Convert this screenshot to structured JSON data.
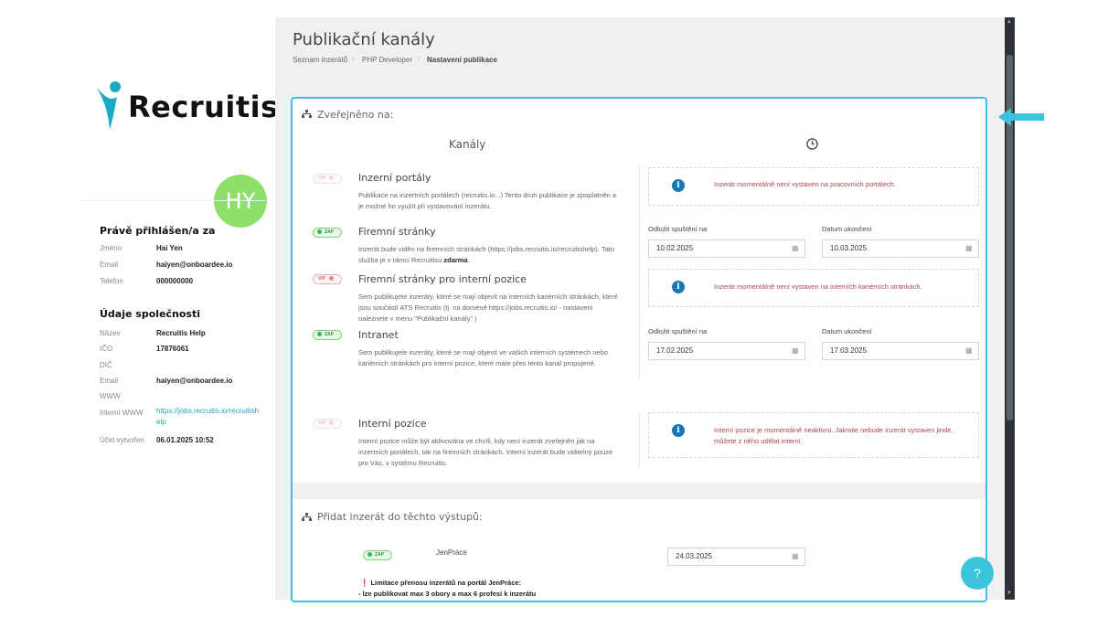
{
  "brand": {
    "logo_text": "Recruitis",
    "accent": "#3cc3dc"
  },
  "user": {
    "initials": "HY",
    "logged_in_title": "Právě přihlášen/a za",
    "fields": [
      {
        "label": "Jméno",
        "value": "Hai Yen"
      },
      {
        "label": "Email",
        "value": "haiyen@onboardee.io"
      },
      {
        "label": "Telefon",
        "value": "000000000"
      }
    ]
  },
  "company": {
    "title": "Údaje společnosti",
    "fields": [
      {
        "label": "Název",
        "value": "Recruitis Help"
      },
      {
        "label": "IČO",
        "value": "17876061"
      },
      {
        "label": "DIČ",
        "value": ""
      },
      {
        "label": "Email",
        "value": "haiyen@onboardee.io"
      },
      {
        "label": "WWW",
        "value": ""
      },
      {
        "label": "Interní WWW",
        "value": "https://jobs.recruitis.io/recruitishelp"
      },
      {
        "label": "Účet vytvořen",
        "value": "06.01.2025 10:52"
      }
    ]
  },
  "page": {
    "title": "Publikační kanály",
    "breadcrumb": [
      "Seznam inzerátů",
      "PHP Developer",
      "Nastavení publikace"
    ]
  },
  "published": {
    "section_title": "Zveřejněno na:",
    "col_channels": "Kanály",
    "channels": [
      {
        "title": "Inzerní portály",
        "toggle": "VIP",
        "desc": "Publikace na inzertních portálech (recruitis.io...) Tento druh publikace je zpoplatněn a je možné ho využít při vystavování inzerátu.",
        "info": "Inzerát momentálně není vystaven na pracovních portálech."
      },
      {
        "title": "Firemní stránky",
        "toggle": "ZAP",
        "desc": "Inzerát bude viděn na firemních stránkách (https://jobs.recruitis.io/recruitishelp). Tato služba je v rámci Recruitisu",
        "desc_bold": "zdarma",
        "desc_end": ".",
        "start_label": "Odložit spuštění na",
        "start_value": "10.02.2025",
        "end_label": "Datum ukončení",
        "end_value": "10.03.2025"
      },
      {
        "title": "Firemní stránky pro interní pozice",
        "toggle": "VIP",
        "desc": "Sem publikujete inzeráty, které se mají objevit na interních kariérních stránkách, které jsou součástí ATS Recruitis (tj. na doméně https://jobs.recruitis.io/ - nastavení naleznete v menu \"Publikační kanály\" )",
        "info": "Inzerát momentálně není vystaven na interních kariérních stránkách."
      },
      {
        "title": "Intranet",
        "toggle": "ZAP",
        "desc": "Sem publikujete inzeráty, které se mají objevit ve vašich interních systémech nebo kariérních stránkách pro interní pozice, které máte přes tento kanál propojené.",
        "start_label": "Odložit spuštění na",
        "start_value": "17.02.2025",
        "end_label": "Datum ukončení",
        "end_value": "17.03.2025"
      },
      {
        "title": "Interní pozice",
        "toggle": "VIP",
        "desc": "Interní pozice může být aktivována ve chvíli, kdy není inzerát zveřejněn jak na inzertních portálech, tak na firemních stránkách. Interní inzerát bude viditelný pouze pro Vás, v systému Recruitis.",
        "info": "Interní pozice je momentálně neaktivní. Jakmile nebude inzerát vystaven jinde, můžete z něho udělat interní."
      }
    ]
  },
  "outputs": {
    "section_title": "Přidat inzerát do těchto výstupů:",
    "item_name": "JenPráce",
    "item_toggle": "ZAP",
    "item_date": "24.03.2025",
    "warning_title": "Limitace přenosu inzerátů na portál JenPráce:",
    "warning_line": "- lze publikovat max 3 obory a max 6 profesí k inzerátu"
  },
  "help_label": "?"
}
